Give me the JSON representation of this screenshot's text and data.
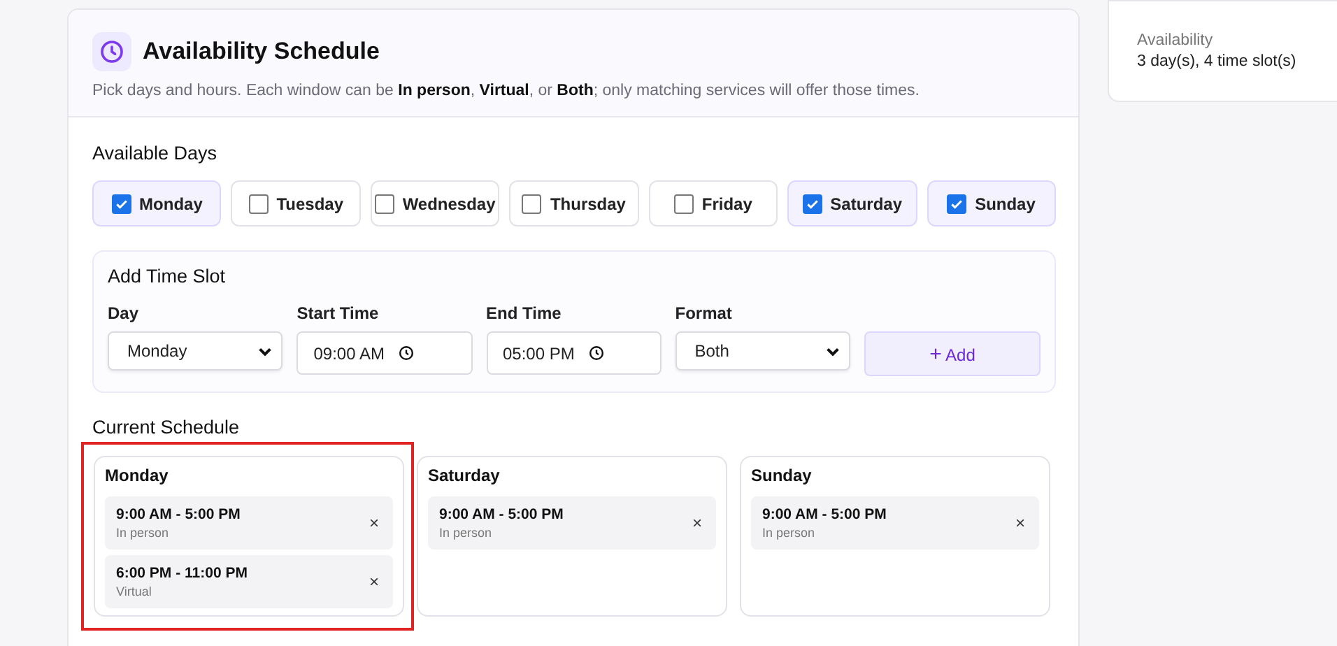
{
  "header": {
    "title": "Availability Schedule",
    "subtitle": "Pick days and hours. Each window can be **In person**, **Virtual**, or **Both**; only matching services will offer those times."
  },
  "summary": {
    "label": "Availability",
    "value": "3 day(s), 4 time slot(s)"
  },
  "available_days": {
    "label": "Available Days",
    "days": [
      {
        "label": "Monday",
        "checked": true
      },
      {
        "label": "Tuesday",
        "checked": false
      },
      {
        "label": "Wednesday",
        "checked": false
      },
      {
        "label": "Thursday",
        "checked": false
      },
      {
        "label": "Friday",
        "checked": false
      },
      {
        "label": "Saturday",
        "checked": true
      },
      {
        "label": "Sunday",
        "checked": true
      }
    ]
  },
  "add_slot": {
    "title": "Add Time Slot",
    "fields": [
      {
        "kind": "select",
        "label": "Day",
        "value": "Monday"
      },
      {
        "kind": "time",
        "label": "Start Time",
        "value": "09:00 AM"
      },
      {
        "kind": "time",
        "label": "End Time",
        "value": "05:00 PM"
      },
      {
        "kind": "select",
        "label": "Format",
        "value": "Both"
      }
    ],
    "button": {
      "icon": "+",
      "label": "Add"
    }
  },
  "current_schedule": {
    "label": "Current Schedule",
    "days": [
      {
        "day": "Monday",
        "highlighted": true,
        "slots": [
          {
            "time": "9:00 AM - 5:00 PM",
            "format": "In person",
            "remove": "×"
          },
          {
            "time": "6:00 PM - 11:00 PM",
            "format": "Virtual",
            "remove": "×"
          }
        ]
      },
      {
        "day": "Saturday",
        "highlighted": false,
        "slots": [
          {
            "time": "9:00 AM - 5:00 PM",
            "format": "In person",
            "remove": "×"
          }
        ]
      },
      {
        "day": "Sunday",
        "highlighted": false,
        "slots": [
          {
            "time": "9:00 AM - 5:00 PM",
            "format": "In person",
            "remove": "×"
          }
        ]
      }
    ]
  }
}
